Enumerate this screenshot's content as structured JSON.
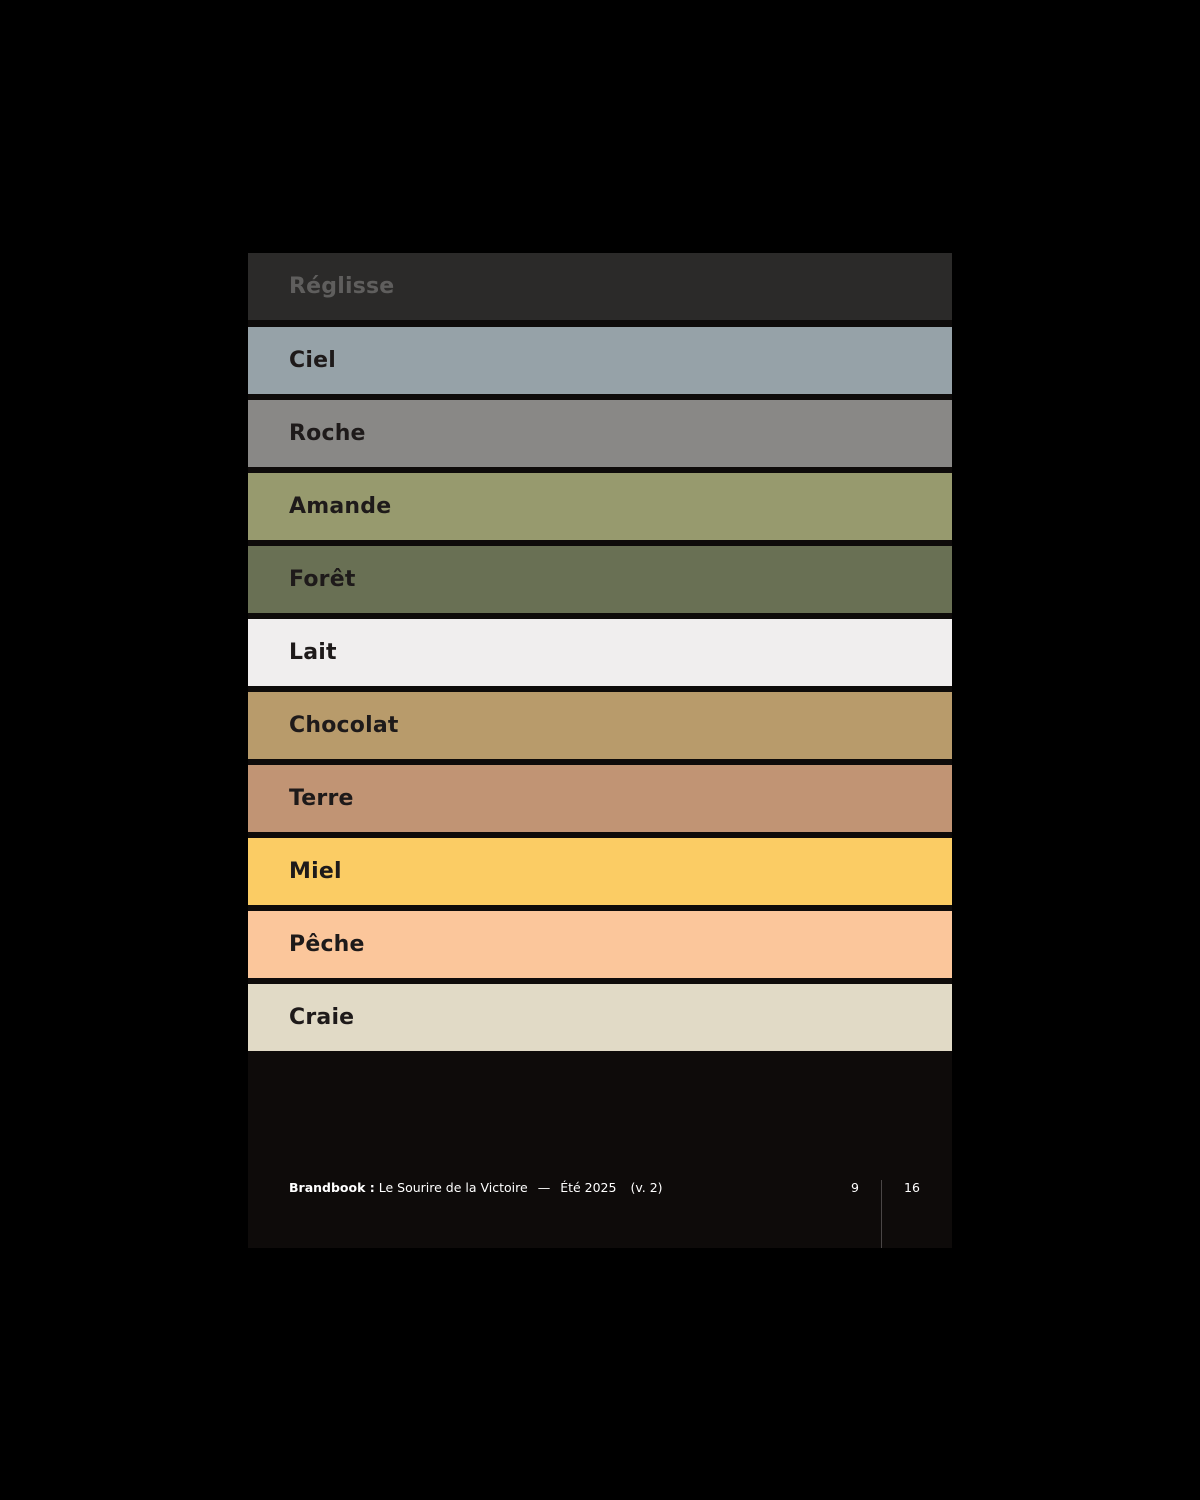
{
  "swatches": [
    {
      "label": "Réglisse",
      "color": "#2b2a29",
      "text_color": "#5f5e5d"
    },
    {
      "label": "Ciel",
      "color": "#96a2a8",
      "text_color": "#1e1a1a"
    },
    {
      "label": "Roche",
      "color": "#898886",
      "text_color": "#1e1a1a"
    },
    {
      "label": "Amande",
      "color": "#979a6e",
      "text_color": "#1e1a1a"
    },
    {
      "label": "Forêt",
      "color": "#697054",
      "text_color": "#1e1a1a"
    },
    {
      "label": "Lait",
      "color": "#f0eeee",
      "text_color": "#1e1a1a"
    },
    {
      "label": "Chocolat",
      "color": "#b89b6b",
      "text_color": "#1e1a1a"
    },
    {
      "label": "Terre",
      "color": "#c19474",
      "text_color": "#1e1a1a"
    },
    {
      "label": "Miel",
      "color": "#fbcc64",
      "text_color": "#1e1a1a"
    },
    {
      "label": "Pêche",
      "color": "#fbc69b",
      "text_color": "#1e1a1a"
    },
    {
      "label": "Craie",
      "color": "#e1dac6",
      "text_color": "#1e1a1a"
    }
  ],
  "footer": {
    "brand": "Brandbook :",
    "title": "Le Sourire de la Victoire",
    "dash": "—",
    "season": "Été 2025",
    "version": "(v. 2)",
    "page_current": "9",
    "page_total": "16"
  }
}
